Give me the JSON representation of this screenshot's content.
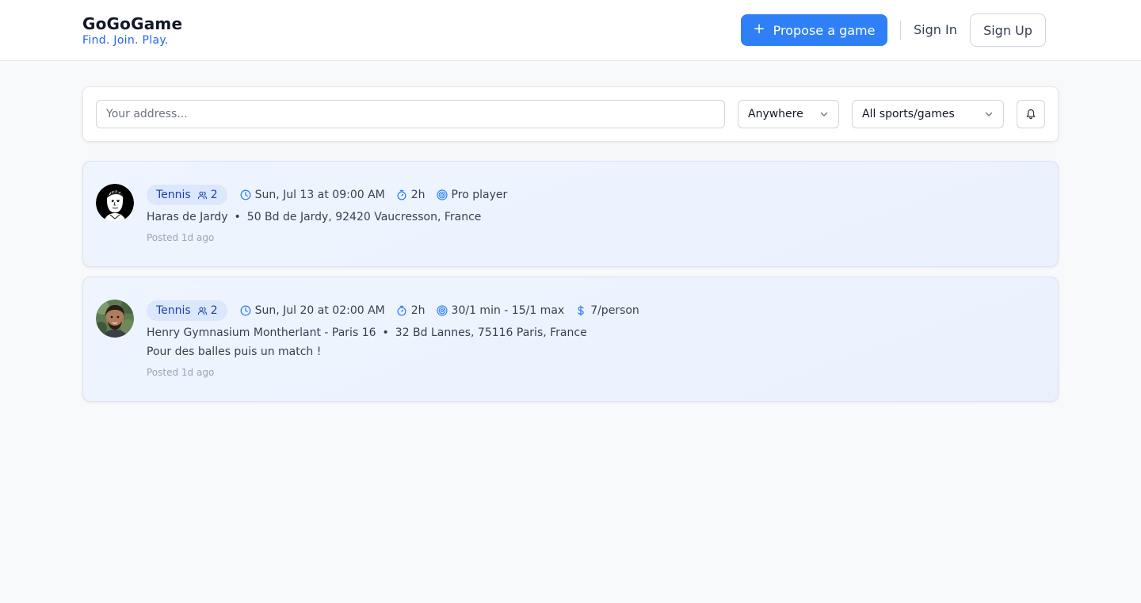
{
  "header": {
    "brand_name": "GoGoGame",
    "brand_tagline": "Find. Join. Play.",
    "propose_label": "Propose a game",
    "signin_label": "Sign In",
    "signup_label": "Sign Up"
  },
  "search": {
    "address_placeholder": "Your address...",
    "address_value": "",
    "distance_selected": "Anywhere",
    "sport_selected": "All sports/games"
  },
  "games": [
    {
      "sport": "Tennis",
      "players": "2",
      "datetime": "Sun, Jul 13 at 09:00 AM",
      "duration": "2h",
      "level": "Pro player",
      "venue": "Haras de Jardy",
      "address": "50 Bd de Jardy, 92420 Vaucresson, France",
      "posted": "Posted 1d ago"
    },
    {
      "sport": "Tennis",
      "players": "2",
      "datetime": "Sun, Jul 20 at 02:00 AM",
      "duration": "2h",
      "level": "30/1 min - 15/1 max",
      "price": "7/person",
      "venue": "Henry Gymnasium Montherlant - Paris 16",
      "address": "32 Bd Lannes, 75116 Paris, France",
      "description": "Pour des balles puis un match !",
      "posted": "Posted 1d ago"
    }
  ],
  "colors": {
    "accent": "#2f80f7",
    "tagline": "#2563eb",
    "badge_bg": "#dbe7fd",
    "badge_text": "#1e40af",
    "card_bg": "#eff5ff"
  },
  "location_separator": "•"
}
